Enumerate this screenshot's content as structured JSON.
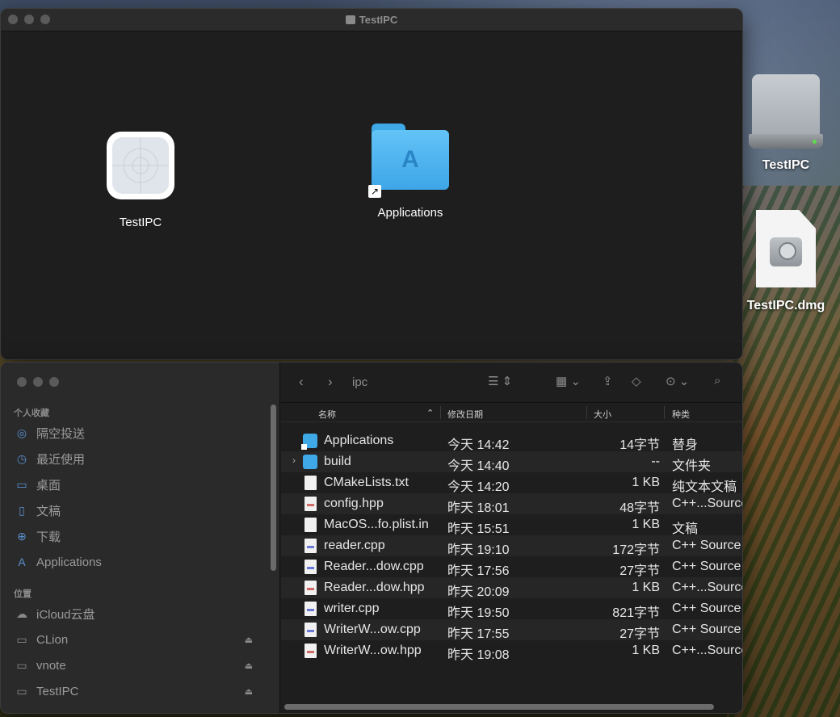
{
  "dmg_window": {
    "title": "TestIPC",
    "items": [
      {
        "label": "TestIPC",
        "icon": "app-icon"
      },
      {
        "label": "Applications",
        "icon": "applications-folder-alias-icon"
      }
    ]
  },
  "desktop": {
    "items": [
      {
        "label": "TestIPC",
        "icon": "mounted-disk-icon"
      },
      {
        "label": "TestIPC.dmg",
        "icon": "disk-image-file-icon"
      }
    ]
  },
  "finder": {
    "folder_name": "ipc",
    "sidebar": {
      "favorites_header": "个人收藏",
      "favorites": [
        {
          "label": "隔空投送",
          "icon": "airdrop-icon"
        },
        {
          "label": "最近使用",
          "icon": "clock-icon"
        },
        {
          "label": "桌面",
          "icon": "desktop-icon"
        },
        {
          "label": "文稿",
          "icon": "document-icon"
        },
        {
          "label": "下载",
          "icon": "download-icon"
        },
        {
          "label": "Applications",
          "icon": "applications-icon"
        }
      ],
      "locations_header": "位置",
      "locations": [
        {
          "label": "iCloud云盘",
          "icon": "cloud-icon"
        },
        {
          "label": "CLion",
          "icon": "disk-icon"
        },
        {
          "label": "vnote",
          "icon": "disk-icon"
        },
        {
          "label": "TestIPC",
          "icon": "disk-icon"
        }
      ]
    },
    "columns": {
      "name": "名称",
      "date": "修改日期",
      "size": "大小",
      "kind": "种类"
    },
    "files": [
      {
        "name": "Applications",
        "date": "今天 14:42",
        "size": "14字节",
        "kind": "替身"
      },
      {
        "name": "build",
        "date": "今天 14:40",
        "size": "--",
        "kind": "文件夹"
      },
      {
        "name": "CMakeLists.txt",
        "date": "今天 14:20",
        "size": "1 KB",
        "kind": "纯文本文稿"
      },
      {
        "name": "config.hpp",
        "date": "昨天 18:01",
        "size": "48字节",
        "kind": "C++...Source"
      },
      {
        "name": "MacOS...fo.plist.in",
        "date": "昨天 15:51",
        "size": "1 KB",
        "kind": "文稿"
      },
      {
        "name": "reader.cpp",
        "date": "昨天 19:10",
        "size": "172字节",
        "kind": "C++ Source"
      },
      {
        "name": "Reader...dow.cpp",
        "date": "昨天 17:56",
        "size": "27字节",
        "kind": "C++ Source"
      },
      {
        "name": "Reader...dow.hpp",
        "date": "昨天 20:09",
        "size": "1 KB",
        "kind": "C++...Source"
      },
      {
        "name": "writer.cpp",
        "date": "昨天 19:50",
        "size": "821字节",
        "kind": "C++ Source"
      },
      {
        "name": "WriterW...ow.cpp",
        "date": "昨天 17:55",
        "size": "27字节",
        "kind": "C++ Source"
      },
      {
        "name": "WriterW...ow.hpp",
        "date": "昨天 19:08",
        "size": "1 KB",
        "kind": "C++...Source"
      }
    ]
  }
}
